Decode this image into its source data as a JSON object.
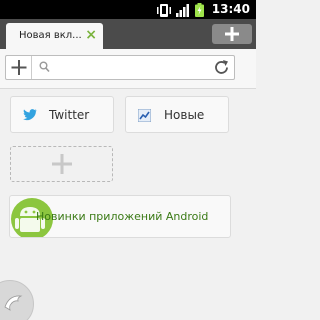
{
  "statusbar": {
    "time": "13:40",
    "icons": [
      "vibrate-icon",
      "signal-icon",
      "battery-charging-icon"
    ]
  },
  "tabs": [
    {
      "title": "Новая вкл...",
      "close_symbol": "×"
    }
  ],
  "toolbar": {
    "url_value": "",
    "url_placeholder": ""
  },
  "speed_dial": {
    "tiles": [
      {
        "label": "Twitter",
        "icon": "twitter-bird-icon"
      },
      {
        "label": "Новые",
        "icon": "trending-chart-icon"
      }
    ],
    "add_tile_icon": "plus-icon"
  },
  "promo": {
    "label": "Новинки приложений Android",
    "icon": "android-robot-icon"
  },
  "colors": {
    "accent_green": "#7ab33e",
    "link_green": "#3a7a15",
    "twitter_blue": "#33a3e0"
  }
}
